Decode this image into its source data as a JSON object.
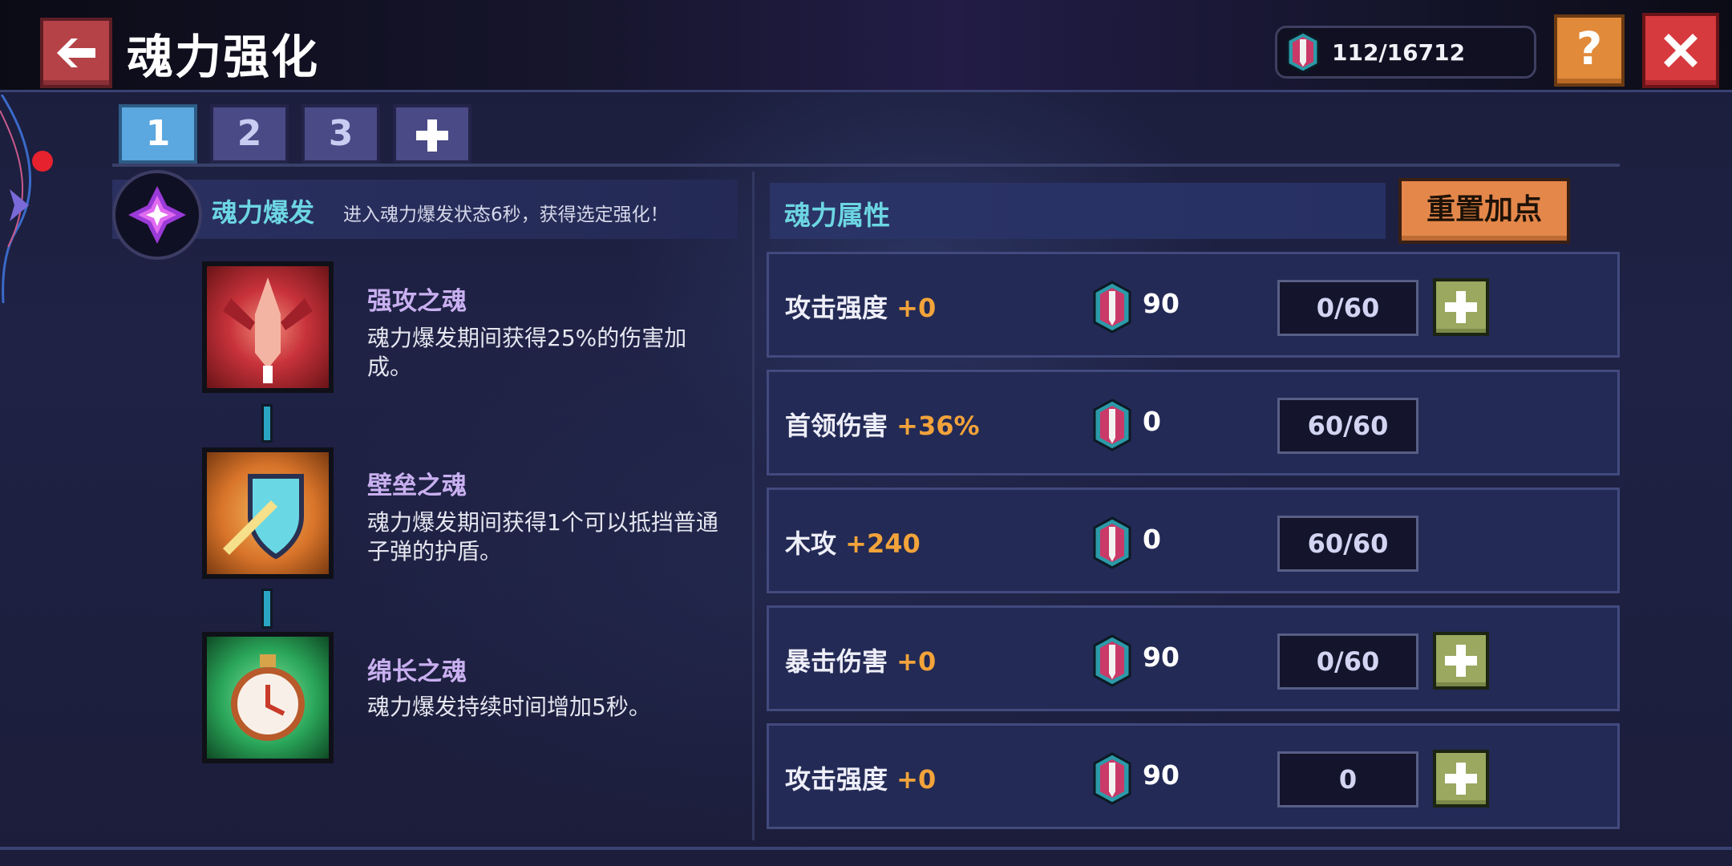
{
  "header": {
    "title": "魂力强化",
    "currency": "112/16712"
  },
  "tabs": [
    {
      "label": "1",
      "active": true
    },
    {
      "label": "2",
      "active": false
    },
    {
      "label": "3",
      "active": false
    }
  ],
  "burst": {
    "title": "魂力爆发",
    "desc": "进入魂力爆发状态6秒，获得选定强化！"
  },
  "skills": [
    {
      "name": "强攻之魂",
      "desc": "魂力爆发期间获得25%的伤害加成。",
      "icon": "attack-soul-icon"
    },
    {
      "name": "壁垒之魂",
      "desc": "魂力爆发期间获得1个可以抵挡普通子弹的护盾。",
      "icon": "shield-soul-icon"
    },
    {
      "name": "绵长之魂",
      "desc": "魂力爆发持续时间增加5秒。",
      "icon": "stopwatch-soul-icon"
    }
  ],
  "attributes": {
    "title": "魂力属性",
    "reset_label": "重置加点",
    "rows": [
      {
        "name": "攻击强度",
        "bonus": "+0",
        "cost": "90",
        "level": "0/60",
        "can_add": true
      },
      {
        "name": "首领伤害",
        "bonus": "+36%",
        "cost": "0",
        "level": "60/60",
        "can_add": false
      },
      {
        "name": "木攻",
        "bonus": "+240",
        "cost": "0",
        "level": "60/60",
        "can_add": false
      },
      {
        "name": "暴击伤害",
        "bonus": "+0",
        "cost": "90",
        "level": "0/60",
        "can_add": true
      },
      {
        "name": "攻击强度",
        "bonus": "+0",
        "cost": "90",
        "level": "0",
        "can_add": true
      }
    ]
  },
  "colors": {
    "accent_cyan": "#6cd6e2",
    "bonus_orange": "#f2a33a",
    "tab_active": "#5ba7df",
    "reset_orange": "#e4874a",
    "close_red": "#d63a3e"
  }
}
